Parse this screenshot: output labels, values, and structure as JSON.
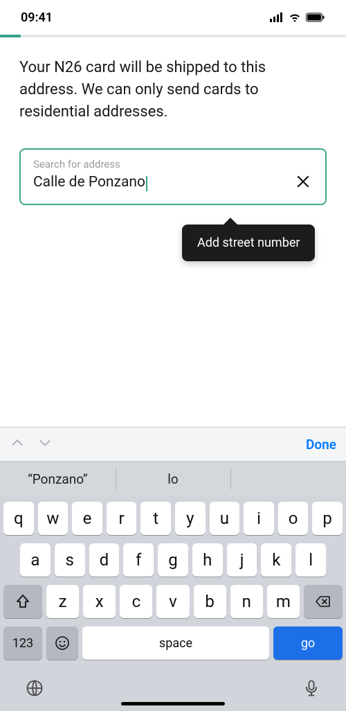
{
  "status": {
    "time": "09:41"
  },
  "heading": "Your N26 card will be shipped to this address. We can only send cards to residential addresses.",
  "search": {
    "label": "Search for address",
    "value": "Calle de Ponzano"
  },
  "tooltip": "Add street number",
  "keyboard": {
    "done": "Done",
    "suggestions": [
      "“Ponzano”",
      "lo",
      ""
    ],
    "row1": [
      "q",
      "w",
      "e",
      "r",
      "t",
      "y",
      "u",
      "i",
      "o",
      "p"
    ],
    "row2": [
      "a",
      "s",
      "d",
      "f",
      "g",
      "h",
      "j",
      "k",
      "l"
    ],
    "row3": [
      "z",
      "x",
      "c",
      "v",
      "b",
      "n",
      "m"
    ],
    "numKey": "123",
    "space": "space",
    "go": "go"
  }
}
